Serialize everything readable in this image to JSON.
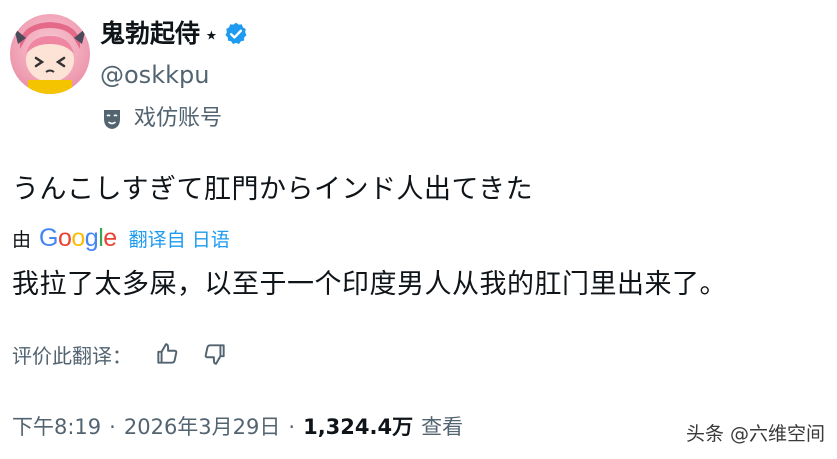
{
  "profile": {
    "display_name": "鬼勃起侍",
    "name_suffix": "⭑",
    "handle": "@oskkpu",
    "parody_label": "戏仿账号",
    "verified_color": "#1d9bf0"
  },
  "tweet": {
    "text": "うんこしすぎて肛門からインド人出てきた"
  },
  "translation": {
    "by_label": "由",
    "provider_letters": [
      "G",
      "o",
      "o",
      "g",
      "l",
      "e"
    ],
    "from_label": "翻译自 日语",
    "text": "我拉了太多屎，以至于一个印度男人从我的肛门里出来了。"
  },
  "rating": {
    "label": "评价此翻译："
  },
  "meta": {
    "time": "下午8:19",
    "separator": "·",
    "date": "2026年3月29日",
    "views_count": "1,324.4万",
    "views_label": "查看"
  },
  "watermark": {
    "text": "头条 @六维空间"
  }
}
